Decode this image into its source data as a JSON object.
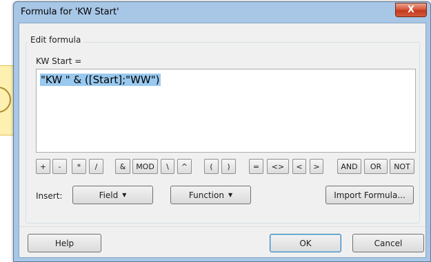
{
  "window": {
    "title": "Formula for 'KW Start'",
    "close_label": "X"
  },
  "edit": {
    "group_label": "Edit formula",
    "field_label": "KW Start =",
    "formula_value": "\"KW \" & ([Start];\"WW\")"
  },
  "operators": [
    "+",
    "-",
    "*",
    "/",
    "&",
    "MOD",
    "\\",
    "^",
    "(",
    ")",
    "=",
    "<>",
    "<",
    ">",
    "AND",
    "OR",
    "NOT"
  ],
  "insert": {
    "label": "Insert:",
    "field_label": "Field",
    "function_label": "Function",
    "import_label": "Import Formula..."
  },
  "footer": {
    "help_label": "Help",
    "ok_label": "OK",
    "cancel_label": "Cancel"
  },
  "colors": {
    "selection": "#99c9ef",
    "close_button": "#c2391c",
    "frame": "#a8c6e6"
  }
}
